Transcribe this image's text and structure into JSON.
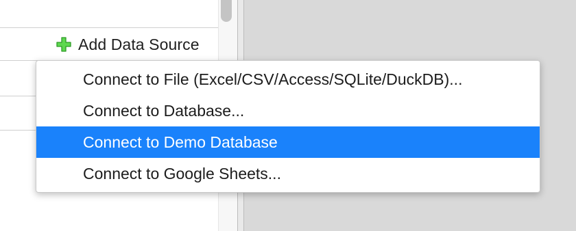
{
  "toolbar": {
    "add_data_source_label": "Add Data Source",
    "add_icon": "plus-icon",
    "add_icon_color": "#43c43a"
  },
  "menu": {
    "items": [
      {
        "label": "Connect to File (Excel/CSV/Access/SQLite/DuckDB)...",
        "selected": false
      },
      {
        "label": "Connect to Database...",
        "selected": false
      },
      {
        "label": "Connect to Demo Database",
        "selected": true
      },
      {
        "label": "Connect to Google Sheets...",
        "selected": false
      }
    ],
    "highlight_color": "#1a82fb"
  }
}
